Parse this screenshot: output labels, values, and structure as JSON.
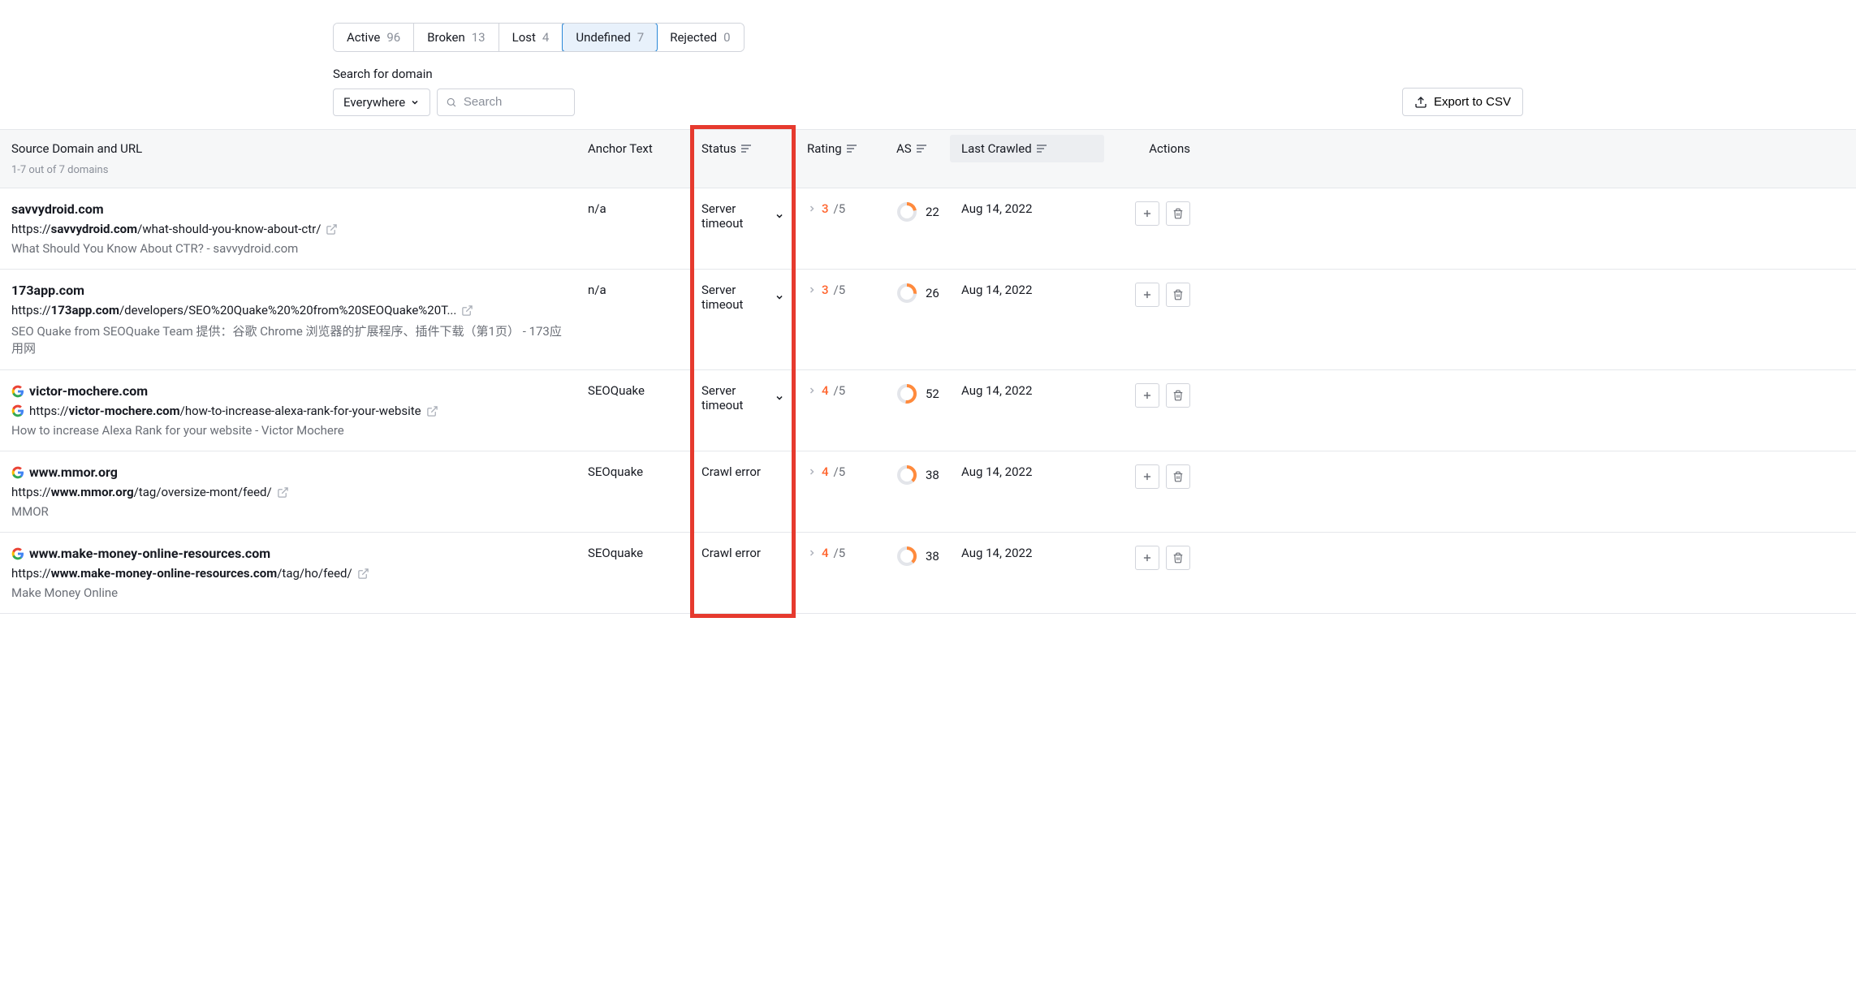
{
  "tabs": [
    {
      "label": "Active",
      "count": "96",
      "active": false
    },
    {
      "label": "Broken",
      "count": "13",
      "active": false
    },
    {
      "label": "Lost",
      "count": "4",
      "active": false
    },
    {
      "label": "Undefined",
      "count": "7",
      "active": true
    },
    {
      "label": "Rejected",
      "count": "0",
      "active": false
    }
  ],
  "searchLabel": "Search for domain",
  "scopeSelect": {
    "label": "Everywhere"
  },
  "searchPlaceholder": "Search",
  "exportButton": "Export to CSV",
  "columns": {
    "source": {
      "label": "Source Domain and URL",
      "sub": "1-7 out of 7 domains"
    },
    "anchor": {
      "label": "Anchor Text"
    },
    "status": {
      "label": "Status"
    },
    "rating": {
      "label": "Rating"
    },
    "as": {
      "label": "AS"
    },
    "crawled": {
      "label": "Last Crawled"
    },
    "actions": {
      "label": "Actions"
    }
  },
  "rows": [
    {
      "domain": "savvydroid.com",
      "urlPrefix": "https://",
      "urlBold": "savvydroid.com",
      "urlRest": "/what-should-you-know-about-ctr/",
      "title": "What Should You Know About CTR? - savvydroid.com",
      "anchor": "n/a",
      "status": "Server timeout",
      "statusDropdown": true,
      "rating": {
        "val": "3",
        "max": "/5"
      },
      "as": {
        "value": "22",
        "pct": 22
      },
      "crawled": "Aug 14, 2022",
      "hasFavicon": false
    },
    {
      "domain": "173app.com",
      "urlPrefix": "https://",
      "urlBold": "173app.com",
      "urlRest": "/developers/SEO%20Quake%20%20from%20SEOQuake%20T...",
      "title": "SEO Quake from SEOQuake Team 提供：谷歌 Chrome 浏览器的扩展程序、插件下载（第1页） - 173应用网",
      "anchor": "n/a",
      "status": "Server timeout",
      "statusDropdown": true,
      "rating": {
        "val": "3",
        "max": "/5"
      },
      "as": {
        "value": "26",
        "pct": 26
      },
      "crawled": "Aug 14, 2022",
      "hasFavicon": false
    },
    {
      "domain": "victor-mochere.com",
      "urlPrefix": "https://",
      "urlBold": "victor-mochere.com",
      "urlRest": "/how-to-increase-alexa-rank-for-your-website",
      "title": "How to increase Alexa Rank for your website - Victor Mochere",
      "anchor": "SEOQuake",
      "status": "Server timeout",
      "statusDropdown": true,
      "rating": {
        "val": "4",
        "max": "/5"
      },
      "as": {
        "value": "52",
        "pct": 52
      },
      "crawled": "Aug 14, 2022",
      "hasFavicon": true,
      "urlFavicon": true
    },
    {
      "domain": "www.mmor.org",
      "urlPrefix": "https://",
      "urlBold": "www.mmor.org",
      "urlRest": "/tag/oversize-mont/feed/",
      "title": "MMOR",
      "anchor": "SEOquake",
      "status": "Crawl error",
      "statusDropdown": false,
      "rating": {
        "val": "4",
        "max": "/5"
      },
      "as": {
        "value": "38",
        "pct": 38
      },
      "crawled": "Aug 14, 2022",
      "hasFavicon": true,
      "urlFavicon": false
    },
    {
      "domain": "www.make-money-online-resources.com",
      "urlPrefix": "https://",
      "urlBold": "www.make-money-online-resources.com",
      "urlRest": "/tag/ho/feed/",
      "title": "Make Money Online",
      "anchor": "SEOquake",
      "status": "Crawl error",
      "statusDropdown": false,
      "rating": {
        "val": "4",
        "max": "/5"
      },
      "as": {
        "value": "38",
        "pct": 38
      },
      "crawled": "Aug 14, 2022",
      "hasFavicon": true,
      "urlFavicon": false
    }
  ],
  "icons": {
    "chevronDown": "⌄",
    "sortGlyph": "≡",
    "externalLink": "↗",
    "plus": "+",
    "trash": "🗑",
    "export": "⤴",
    "search": "🔍",
    "ratingArrow": "›"
  }
}
